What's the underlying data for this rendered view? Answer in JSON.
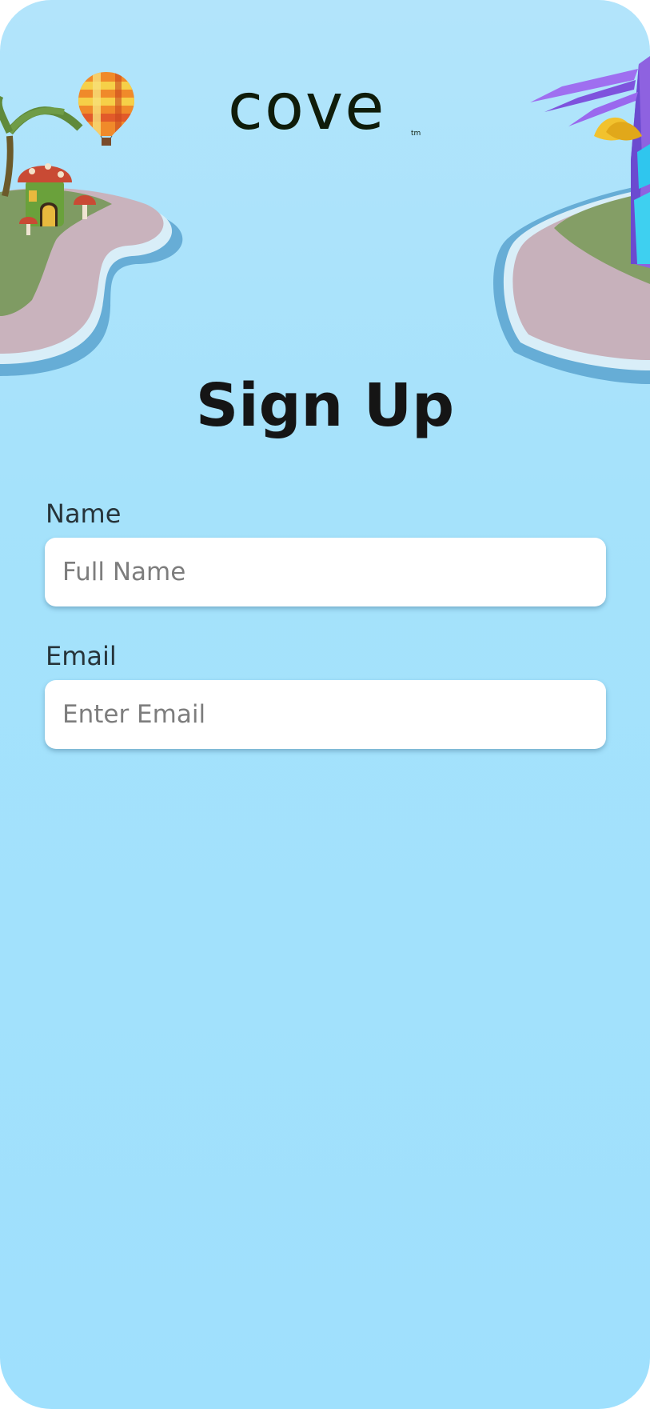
{
  "brand": {
    "logo_text": "cove",
    "trademark": "tm"
  },
  "page": {
    "title": "Sign Up"
  },
  "form": {
    "name": {
      "label": "Name",
      "placeholder": "Full Name",
      "value": ""
    },
    "email": {
      "label": "Email",
      "placeholder": "Enter Email",
      "value": ""
    }
  },
  "colors": {
    "background": "#a5e2fb",
    "title_text": "#151515",
    "label_text": "#27343a",
    "input_background": "#ffffff",
    "placeholder_text": "#7d7d7d",
    "logo": "#0f1c0a"
  },
  "icons": {
    "balloon": "hot-air-balloon-icon",
    "left_decoration": "island-left-illustration",
    "right_decoration": "island-right-illustration",
    "logo_palm": "palm-tree-icon"
  }
}
